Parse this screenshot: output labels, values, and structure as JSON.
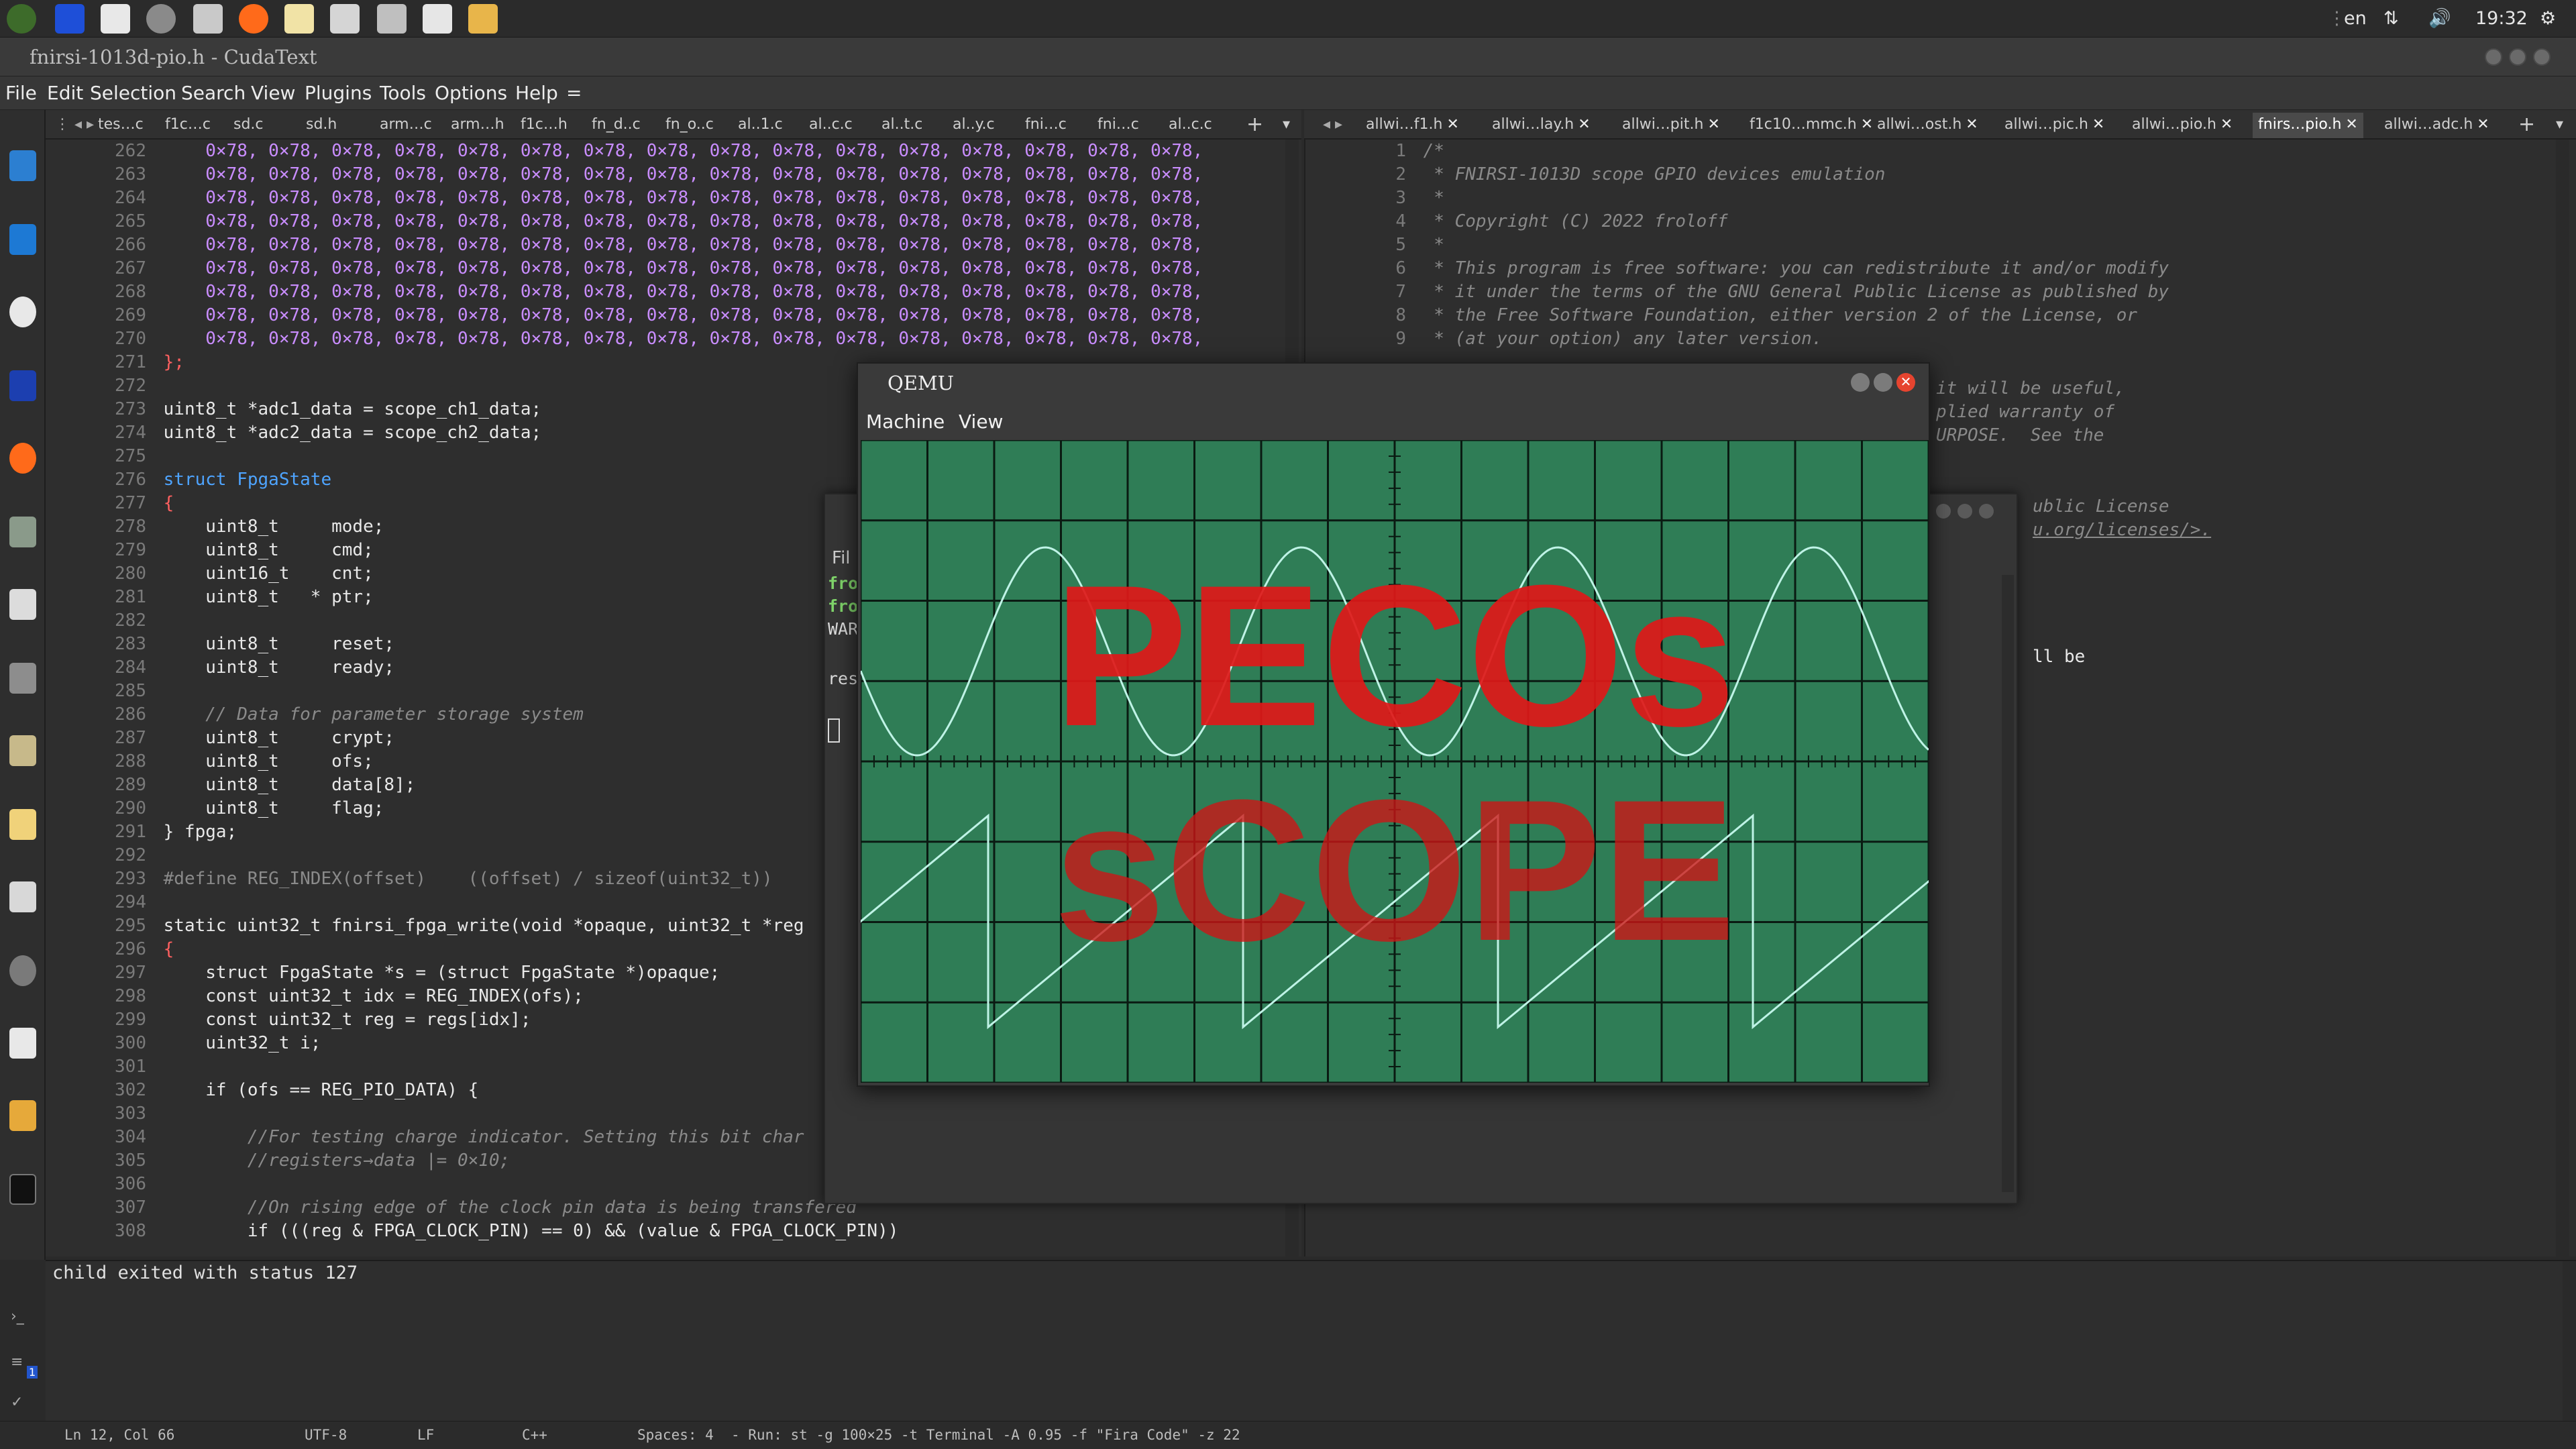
{
  "topbar": {
    "lang": "en",
    "clock": "19:32",
    "apps": [
      "ubuntu-logo-icon",
      "calendar-icon",
      "pdf-icon",
      "settings-icon",
      "storage-icon",
      "firefox-icon",
      "file-icon",
      "wrench-icon",
      "calculator-icon",
      "editor-icon",
      "archive-icon"
    ]
  },
  "window": {
    "title": "fnirsi-1013d-pio.h - CudaText",
    "menu": [
      "File",
      "Edit",
      "Selection",
      "Search",
      "View",
      "Plugins",
      "Tools",
      "Options",
      "Help",
      "="
    ]
  },
  "dock": [
    "anchor-icon",
    "terminal-blue-icon",
    "clock-icon",
    "file-manager-icon",
    "firefox-icon",
    "system-tools-icon",
    "text-editor-icon",
    "calculator-icon",
    "image-viewer-icon",
    "image-icon",
    "drive-icon",
    "help-icon",
    "pdf-icon",
    "clipboard-icon",
    "terminal-icon"
  ],
  "left_tabs": [
    "tes…c",
    "f1c…c",
    "sd.c",
    "sd.h",
    "arm…c",
    "arm…h",
    "f1c…h",
    "fn_d..c",
    "fn_o..c",
    "al..1.c",
    "al..c.c",
    "al..t.c",
    "al..y.c",
    "fni…c",
    "fni…c",
    "al..c.c",
    "+"
  ],
  "right_tabs": [
    "allwi…f1.h",
    "allwi…lay.h",
    "allwi…pit.h",
    "f1c10…mmc.h",
    "allwi…ost.h",
    "allwi…pic.h",
    "allwi…pio.h",
    "fnirs…pio.h",
    "allwi…adc.h",
    "+"
  ],
  "left_code": [
    {
      "n": "262",
      "t": "    0×78, 0×78, 0×78, 0×78, 0×78, 0×78, 0×78, 0×78, 0×78, 0×78, 0×78, 0×78, 0×78, 0×78, 0×78, 0×78,",
      "k": "num"
    },
    {
      "n": "263",
      "t": "    0×78, 0×78, 0×78, 0×78, 0×78, 0×78, 0×78, 0×78, 0×78, 0×78, 0×78, 0×78, 0×78, 0×78, 0×78, 0×78,",
      "k": "num"
    },
    {
      "n": "264",
      "t": "    0×78, 0×78, 0×78, 0×78, 0×78, 0×78, 0×78, 0×78, 0×78, 0×78, 0×78, 0×78, 0×78, 0×78, 0×78, 0×78,",
      "k": "num"
    },
    {
      "n": "265",
      "t": "    0×78, 0×78, 0×78, 0×78, 0×78, 0×78, 0×78, 0×78, 0×78, 0×78, 0×78, 0×78, 0×78, 0×78, 0×78, 0×78,",
      "k": "num"
    },
    {
      "n": "266",
      "t": "    0×78, 0×78, 0×78, 0×78, 0×78, 0×78, 0×78, 0×78, 0×78, 0×78, 0×78, 0×78, 0×78, 0×78, 0×78, 0×78,",
      "k": "num"
    },
    {
      "n": "267",
      "t": "    0×78, 0×78, 0×78, 0×78, 0×78, 0×78, 0×78, 0×78, 0×78, 0×78, 0×78, 0×78, 0×78, 0×78, 0×78, 0×78,",
      "k": "num"
    },
    {
      "n": "268",
      "t": "    0×78, 0×78, 0×78, 0×78, 0×78, 0×78, 0×78, 0×78, 0×78, 0×78, 0×78, 0×78, 0×78, 0×78, 0×78, 0×78,",
      "k": "num"
    },
    {
      "n": "269",
      "t": "    0×78, 0×78, 0×78, 0×78, 0×78, 0×78, 0×78, 0×78, 0×78, 0×78, 0×78, 0×78, 0×78, 0×78, 0×78, 0×78,",
      "k": "num"
    },
    {
      "n": "270",
      "t": "    0×78, 0×78, 0×78, 0×78, 0×78, 0×78, 0×78, 0×78, 0×78, 0×78, 0×78, 0×78, 0×78, 0×78, 0×78, 0×78,",
      "k": "num"
    },
    {
      "n": "271",
      "t": "};",
      "k": "op"
    },
    {
      "n": "272",
      "t": "",
      "k": ""
    },
    {
      "n": "273",
      "t": "uint8_t *adc1_data = scope_ch1_data;",
      "k": ""
    },
    {
      "n": "274",
      "t": "uint8_t *adc2_data = scope_ch2_data;",
      "k": ""
    },
    {
      "n": "275",
      "t": "",
      "k": ""
    },
    {
      "n": "276",
      "t": "struct FpgaState",
      "k": "kw"
    },
    {
      "n": "277",
      "t": "{",
      "k": "op"
    },
    {
      "n": "278",
      "t": "    uint8_t     mode;",
      "k": ""
    },
    {
      "n": "279",
      "t": "    uint8_t     cmd;",
      "k": ""
    },
    {
      "n": "280",
      "t": "    uint16_t    cnt;",
      "k": ""
    },
    {
      "n": "281",
      "t": "    uint8_t   * ptr;",
      "k": ""
    },
    {
      "n": "282",
      "t": "",
      "k": ""
    },
    {
      "n": "283",
      "t": "    uint8_t     reset;",
      "k": ""
    },
    {
      "n": "284",
      "t": "    uint8_t     ready;",
      "k": ""
    },
    {
      "n": "285",
      "t": "",
      "k": ""
    },
    {
      "n": "286",
      "t": "    // Data for parameter storage system",
      "k": "cm"
    },
    {
      "n": "287",
      "t": "    uint8_t     crypt;",
      "k": ""
    },
    {
      "n": "288",
      "t": "    uint8_t     ofs;",
      "k": ""
    },
    {
      "n": "289",
      "t": "    uint8_t     data[8];",
      "k": ""
    },
    {
      "n": "290",
      "t": "    uint8_t     flag;",
      "k": ""
    },
    {
      "n": "291",
      "t": "} fpga;",
      "k": ""
    },
    {
      "n": "292",
      "t": "",
      "k": ""
    },
    {
      "n": "293",
      "t": "#define REG_INDEX(offset)    ((offset) / sizeof(uint32_t))",
      "k": "def"
    },
    {
      "n": "294",
      "t": "",
      "k": ""
    },
    {
      "n": "295",
      "t": "static uint32_t fnirsi_fpga_write(void *opaque, uint32_t *reg",
      "k": ""
    },
    {
      "n": "296",
      "t": "{",
      "k": "op"
    },
    {
      "n": "297",
      "t": "    struct FpgaState *s = (struct FpgaState *)opaque;",
      "k": ""
    },
    {
      "n": "298",
      "t": "    const uint32_t idx = REG_INDEX(ofs);",
      "k": ""
    },
    {
      "n": "299",
      "t": "    const uint32_t reg = regs[idx];",
      "k": ""
    },
    {
      "n": "300",
      "t": "    uint32_t i;",
      "k": ""
    },
    {
      "n": "301",
      "t": "",
      "k": ""
    },
    {
      "n": "302",
      "t": "    if (ofs == REG_PIO_DATA) {",
      "k": ""
    },
    {
      "n": "303",
      "t": "",
      "k": ""
    },
    {
      "n": "304",
      "t": "        //For testing charge indicator. Setting this bit char",
      "k": "cm"
    },
    {
      "n": "305",
      "t": "        //registers→data |= 0×10;",
      "k": "cm"
    },
    {
      "n": "306",
      "t": "",
      "k": ""
    },
    {
      "n": "307",
      "t": "        //On rising edge of the clock pin data is being transfered",
      "k": "cm"
    },
    {
      "n": "308",
      "t": "        if (((reg & FPGA_CLOCK_PIN) == 0) && (value & FPGA_CLOCK_PIN))",
      "k": ""
    }
  ],
  "right_code": [
    {
      "n": "1",
      "t": "/*"
    },
    {
      "n": "2",
      "t": " * FNIRSI-1013D scope GPIO devices emulation"
    },
    {
      "n": "3",
      "t": " *"
    },
    {
      "n": "4",
      "t": " * Copyright (C) 2022 froloff"
    },
    {
      "n": "5",
      "t": " *"
    },
    {
      "n": "6",
      "t": " * This program is free software: you can redistribute it and/or modify"
    },
    {
      "n": "7",
      "t": " * it under the terms of the GNU General Public License as published by"
    },
    {
      "n": "8",
      "t": " * the Free Software Foundation, either version 2 of the License, or"
    },
    {
      "n": "9",
      "t": " * (at your option) any later version."
    }
  ],
  "right_fragments": [
    "it will be useful,",
    "plied warranty of",
    "URPOSE.  See the",
    "ublic License",
    "u.org/licenses/>.",
    "ll be"
  ],
  "bg_window": {
    "lines": [
      "Fil",
      "fro",
      "fro",
      "WAR",
      "res"
    ]
  },
  "qemu": {
    "title": "QEMU",
    "menu": [
      "Machine",
      "View"
    ],
    "screen": {
      "line1": "PECOs",
      "line2": "sCOPE"
    }
  },
  "panel": {
    "text": "child exited with status 127"
  },
  "statusbar": {
    "pos": "Ln 12, Col 66",
    "encoding": "UTF-8",
    "eol": "LF",
    "lexer": "C++",
    "spaces": "Spaces: 4",
    "run": "-  Run: st -g 100×25 -t Terminal -A 0.95 -f \"Fira Code\" -z 22"
  },
  "colors": {
    "scope_bg": "#2f7d56",
    "trace": "#bff3e6",
    "overlay_text": "#e01818"
  }
}
